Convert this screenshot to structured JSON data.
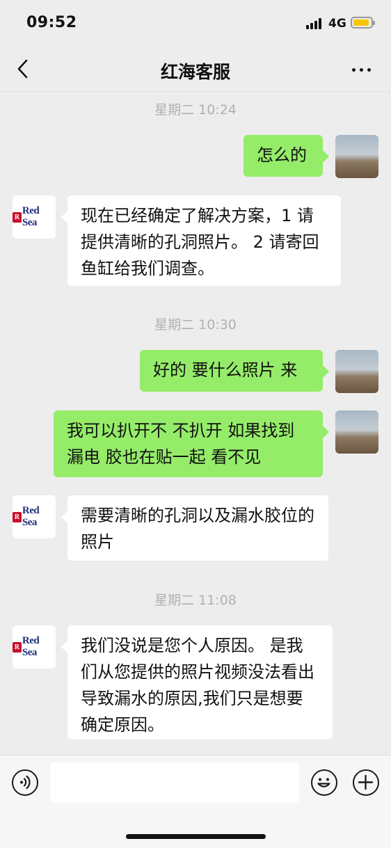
{
  "status_bar": {
    "time": "09:52",
    "network": "4G"
  },
  "header": {
    "title": "红海客服"
  },
  "colors": {
    "background": "#ededed",
    "sent_bubble": "#95ec69",
    "received_bubble": "#ffffff",
    "battery": "#f7c600"
  },
  "messages": [
    {
      "type": "timestamp",
      "text": "星期二 10:24"
    },
    {
      "type": "sent",
      "text": "怎么的"
    },
    {
      "type": "received",
      "text": "现在已经确定了解决方案，1 请提供清晰的孔洞照片。 2 请寄回鱼缸给我们调查。"
    },
    {
      "type": "timestamp",
      "text": "星期二 10:30"
    },
    {
      "type": "sent",
      "text": "好的 要什么照片 来"
    },
    {
      "type": "sent",
      "text": "我可以扒开不 不扒开 如果找到漏电 胶也在贴一起 看不见"
    },
    {
      "type": "received",
      "text": "需要清晰的孔洞以及漏水胶位的照片"
    },
    {
      "type": "timestamp",
      "text": "星期二 11:08"
    },
    {
      "type": "received",
      "text": "我们没说是您个人原因。 是我们从您提供的照片视频没法看出导致漏水的原因,我们只是想要确定原因。"
    }
  ],
  "avatars": {
    "service_logo_mark": "R",
    "service_logo_text": "Red Sea"
  },
  "input_bar": {
    "voice_icon": "voice-icon",
    "emoji_icon": "emoji-icon",
    "plus_icon": "plus-icon"
  }
}
